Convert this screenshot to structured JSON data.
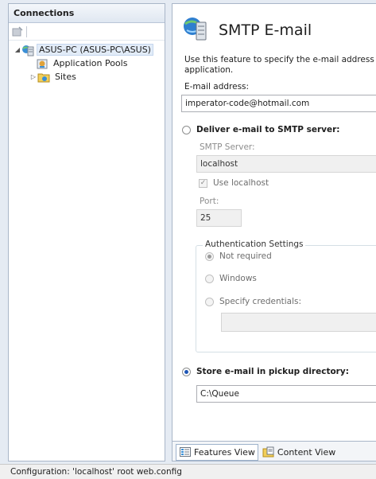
{
  "connections": {
    "header": "Connections",
    "tree": [
      {
        "label": "ASUS-PC (ASUS-PC\\ASUS)",
        "expander": "◢"
      },
      {
        "label": "Application Pools"
      },
      {
        "label": "Sites",
        "expander": "▷"
      }
    ]
  },
  "main": {
    "title": "SMTP E-mail",
    "description_line1": "Use this feature to specify the e-mail address a",
    "description_line2": "application.",
    "email_label": "E-mail address:",
    "email_value": "imperator-code@hotmail.com",
    "deliver_smtp_label": "Deliver e-mail to SMTP server:",
    "smtp_server_label": "SMTP Server:",
    "smtp_server_value": "localhost",
    "use_localhost_label": "Use localhost",
    "use_localhost_mark": "✓",
    "port_label": "Port:",
    "port_value": "25",
    "auth_legend": "Authentication Settings",
    "auth_options": [
      "Not required",
      "Windows",
      "Specify credentials:"
    ],
    "store_pickup_label": "Store e-mail in pickup directory:",
    "pickup_value": "C:\\Queue"
  },
  "tabs": {
    "features_view": "Features View",
    "content_view": "Content View"
  },
  "status": {
    "text": "Configuration: 'localhost' root web.config"
  },
  "colors": {
    "accent": "#1f56b6",
    "pane_border": "#a9b6c8",
    "background": "#e5ebf3"
  }
}
